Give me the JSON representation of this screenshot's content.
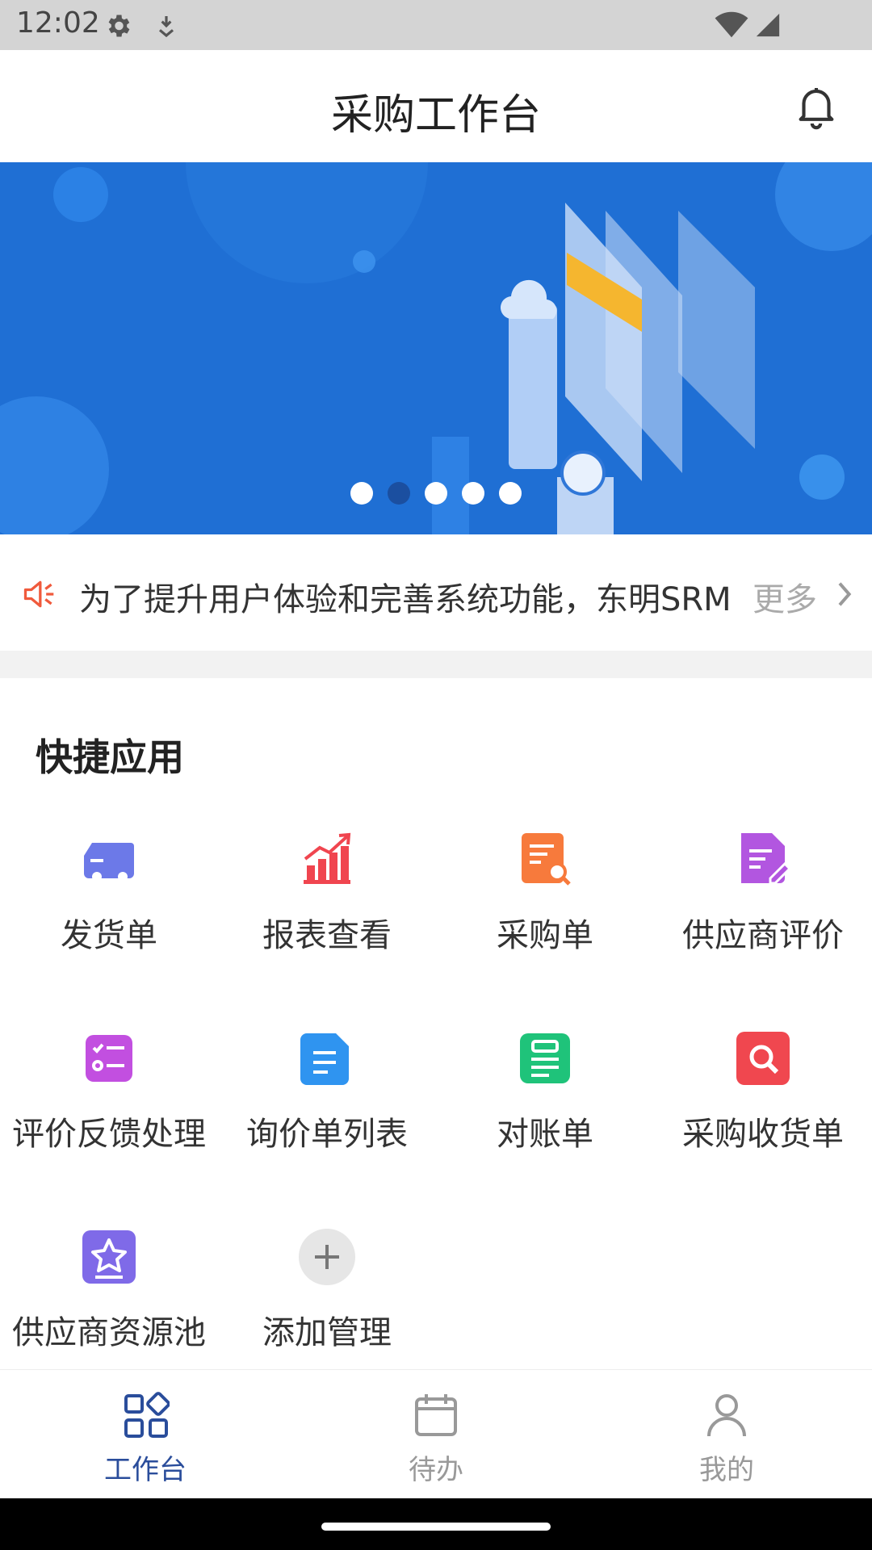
{
  "status": {
    "time": "12:02"
  },
  "header": {
    "title": "采购工作台"
  },
  "banner": {
    "dots": 5,
    "active_dot": 2
  },
  "notice": {
    "text": "为了提升用户体验和完善系统功能，东明SRM",
    "more_label": "更多"
  },
  "quick_apps": {
    "title": "快捷应用",
    "items": [
      {
        "label": "发货单",
        "icon": "truck-icon",
        "color": "#6c79e8"
      },
      {
        "label": "报表查看",
        "icon": "bar-chart-icon",
        "color": "#f0454f"
      },
      {
        "label": "采购单",
        "icon": "document-search-icon",
        "color": "#f77a3c"
      },
      {
        "label": "供应商评价",
        "icon": "document-edit-icon",
        "color": "#b256e0"
      },
      {
        "label": "评价反馈处理",
        "icon": "checklist-icon",
        "color": "#c24fe0"
      },
      {
        "label": "询价单列表",
        "icon": "file-list-icon",
        "color": "#2f94f0"
      },
      {
        "label": "对账单",
        "icon": "receipt-icon",
        "color": "#1fc37a"
      },
      {
        "label": "采购收货单",
        "icon": "search-icon",
        "color": "#f0474f"
      },
      {
        "label": "供应商资源池",
        "icon": "star-badge-icon",
        "color": "#7f6ae8"
      },
      {
        "label": "添加管理",
        "icon": "plus-icon",
        "color": "#e6e6e6"
      }
    ]
  },
  "tabbar": {
    "tabs": [
      {
        "label": "工作台",
        "icon": "workbench-icon",
        "active": true
      },
      {
        "label": "待办",
        "icon": "calendar-icon",
        "active": false
      },
      {
        "label": "我的",
        "icon": "user-icon",
        "active": false
      }
    ]
  },
  "colors": {
    "accent": "#2a4d9b",
    "banner_bg": "#1f6fd4",
    "notice_icon": "#f05a3c"
  }
}
